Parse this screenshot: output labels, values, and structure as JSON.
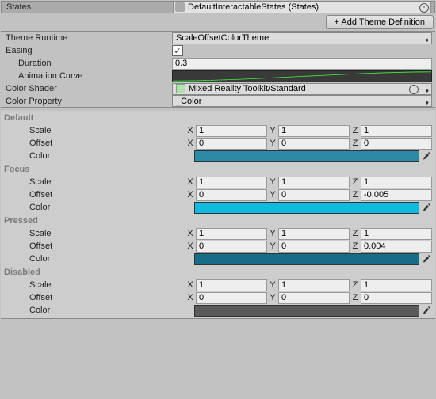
{
  "states_label": "States",
  "states_value": "DefaultInteractableStates (States)",
  "add_theme_label": "+ Add Theme Definition",
  "theme_runtime_label": "Theme Runtime",
  "theme_runtime_value": "ScaleOffsetColorTheme",
  "easing_label": "Easing",
  "easing_checked": "✓",
  "duration_label": "Duration",
  "duration_value": "0.3",
  "anim_curve_label": "Animation Curve",
  "color_shader_label": "Color Shader",
  "color_shader_value": "Mixed Reality Toolkit/Standard",
  "color_prop_label": "Color Property",
  "color_prop_value": "_Color",
  "axis_x": "X",
  "axis_y": "Y",
  "axis_z": "Z",
  "prop_scale": "Scale",
  "prop_offset": "Offset",
  "prop_color": "Color",
  "states": [
    {
      "name": "Default",
      "scale": [
        "1",
        "1",
        "1"
      ],
      "offset": [
        "0",
        "0",
        "0"
      ],
      "color": "#2b8aa6"
    },
    {
      "name": "Focus",
      "scale": [
        "1",
        "1",
        "1"
      ],
      "offset": [
        "0",
        "0",
        "-0.005"
      ],
      "color": "#11bbe0"
    },
    {
      "name": "Pressed",
      "scale": [
        "1",
        "1",
        "1"
      ],
      "offset": [
        "0",
        "0",
        "0.004"
      ],
      "color": "#166d88"
    },
    {
      "name": "Disabled",
      "scale": [
        "1",
        "1",
        "1"
      ],
      "offset": [
        "0",
        "0",
        "0"
      ],
      "color": "#5a5a5a"
    }
  ]
}
